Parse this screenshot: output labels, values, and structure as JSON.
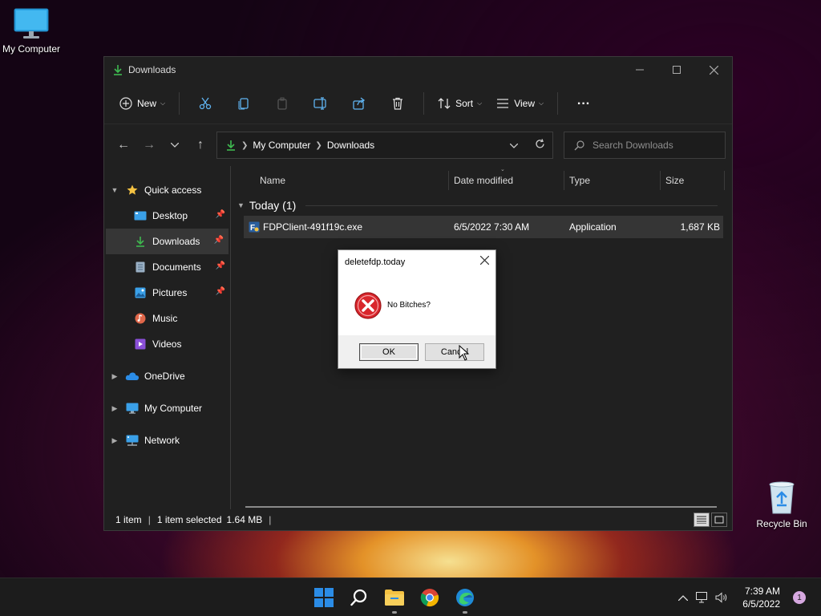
{
  "desktop": {
    "my_computer_label": "My Computer",
    "recycle_bin_label": "Recycle Bin"
  },
  "window": {
    "title": "Downloads",
    "toolbar": {
      "new_label": "New",
      "sort_label": "Sort",
      "view_label": "View",
      "more_label": "..."
    },
    "address": {
      "crumbs": [
        "My Computer",
        "Downloads"
      ],
      "search_placeholder": "Search Downloads"
    },
    "nav": {
      "quick_access": "Quick access",
      "items": [
        {
          "label": "Desktop",
          "icon": "desktop-icon",
          "pinned": true
        },
        {
          "label": "Downloads",
          "icon": "download-icon",
          "pinned": true,
          "selected": true
        },
        {
          "label": "Documents",
          "icon": "document-icon",
          "pinned": true
        },
        {
          "label": "Pictures",
          "icon": "pictures-icon",
          "pinned": true
        },
        {
          "label": "Music",
          "icon": "music-icon",
          "pinned": false
        },
        {
          "label": "Videos",
          "icon": "videos-icon",
          "pinned": false
        }
      ],
      "roots": [
        "OneDrive",
        "My Computer",
        "Network"
      ]
    },
    "columns": [
      "Name",
      "Date modified",
      "Type",
      "Size"
    ],
    "group_label": "Today (1)",
    "files": [
      {
        "name": "FDPClient-491f19c.exe",
        "date": "6/5/2022 7:30 AM",
        "type": "Application",
        "size": "1,687 KB"
      }
    ],
    "status": {
      "count": "1 item",
      "selected": "1 item selected",
      "size": "1.64 MB"
    }
  },
  "dialog": {
    "title": "deletefdp.today",
    "message": "No Bitches?",
    "ok_label": "OK",
    "cancel_label": "Cancel"
  },
  "taskbar": {
    "time": "7:39 AM",
    "date": "6/5/2022",
    "notification_count": "1"
  },
  "colors": {
    "accent_green": "#3fb950",
    "error_red": "#d9262c",
    "folder_yellow": "#f5c242",
    "win_blue": "#2b8ce6"
  }
}
